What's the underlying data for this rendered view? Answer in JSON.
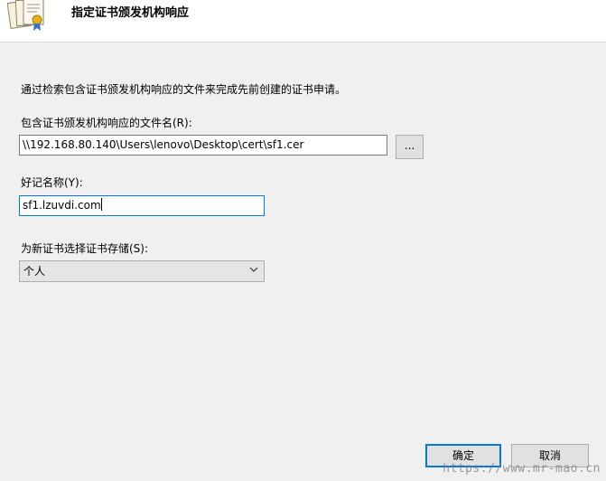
{
  "header": {
    "title": "指定证书颁发机构响应"
  },
  "instruction": "通过检索包含证书颁发机构响应的文件来完成先前创建的证书申请。",
  "file_field": {
    "label": "包含证书颁发机构响应的文件名(R):",
    "value": "\\\\192.168.80.140\\Users\\lenovo\\Desktop\\cert\\sf1.cer",
    "browse_label": "..."
  },
  "friendly_name": {
    "label": "好记名称(Y):",
    "value": "sf1.lzuvdi.com"
  },
  "store": {
    "label": "为新证书选择证书存储(S):",
    "selected": "个人"
  },
  "buttons": {
    "ok": "确定",
    "cancel": "取消"
  },
  "watermark": "https://www.mr-mao.cn",
  "colors": {
    "accent": "#0078d7",
    "background": "#f0f0f0",
    "header": "#ffffff"
  }
}
